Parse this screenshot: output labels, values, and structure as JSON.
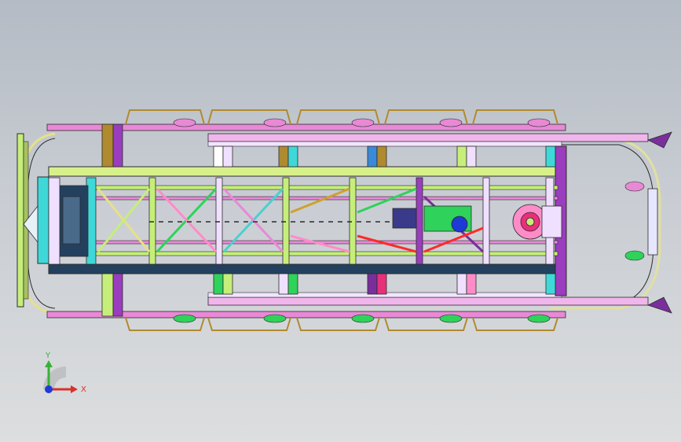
{
  "viewport": {
    "background_top": "#b4bbc4",
    "background_bottom": "#dcdedf"
  },
  "triad": {
    "x_label": "X",
    "y_label": "Y",
    "x_color": "#d8322a",
    "y_color": "#3ab03a",
    "z_color": "#1e3bd6"
  },
  "model": {
    "frame_outline": "#2b2b2b",
    "colors": [
      "#e889d6",
      "#b8e0ff",
      "#f0e0ff",
      "#c6ee7a",
      "#23415e",
      "#9a3dbe",
      "#e8307a",
      "#3fd8d8",
      "#b08a2e",
      "#7a2e9c",
      "#2fd25a",
      "#ff2a2a",
      "#ff8cc8",
      "#4ad0d0"
    ]
  }
}
